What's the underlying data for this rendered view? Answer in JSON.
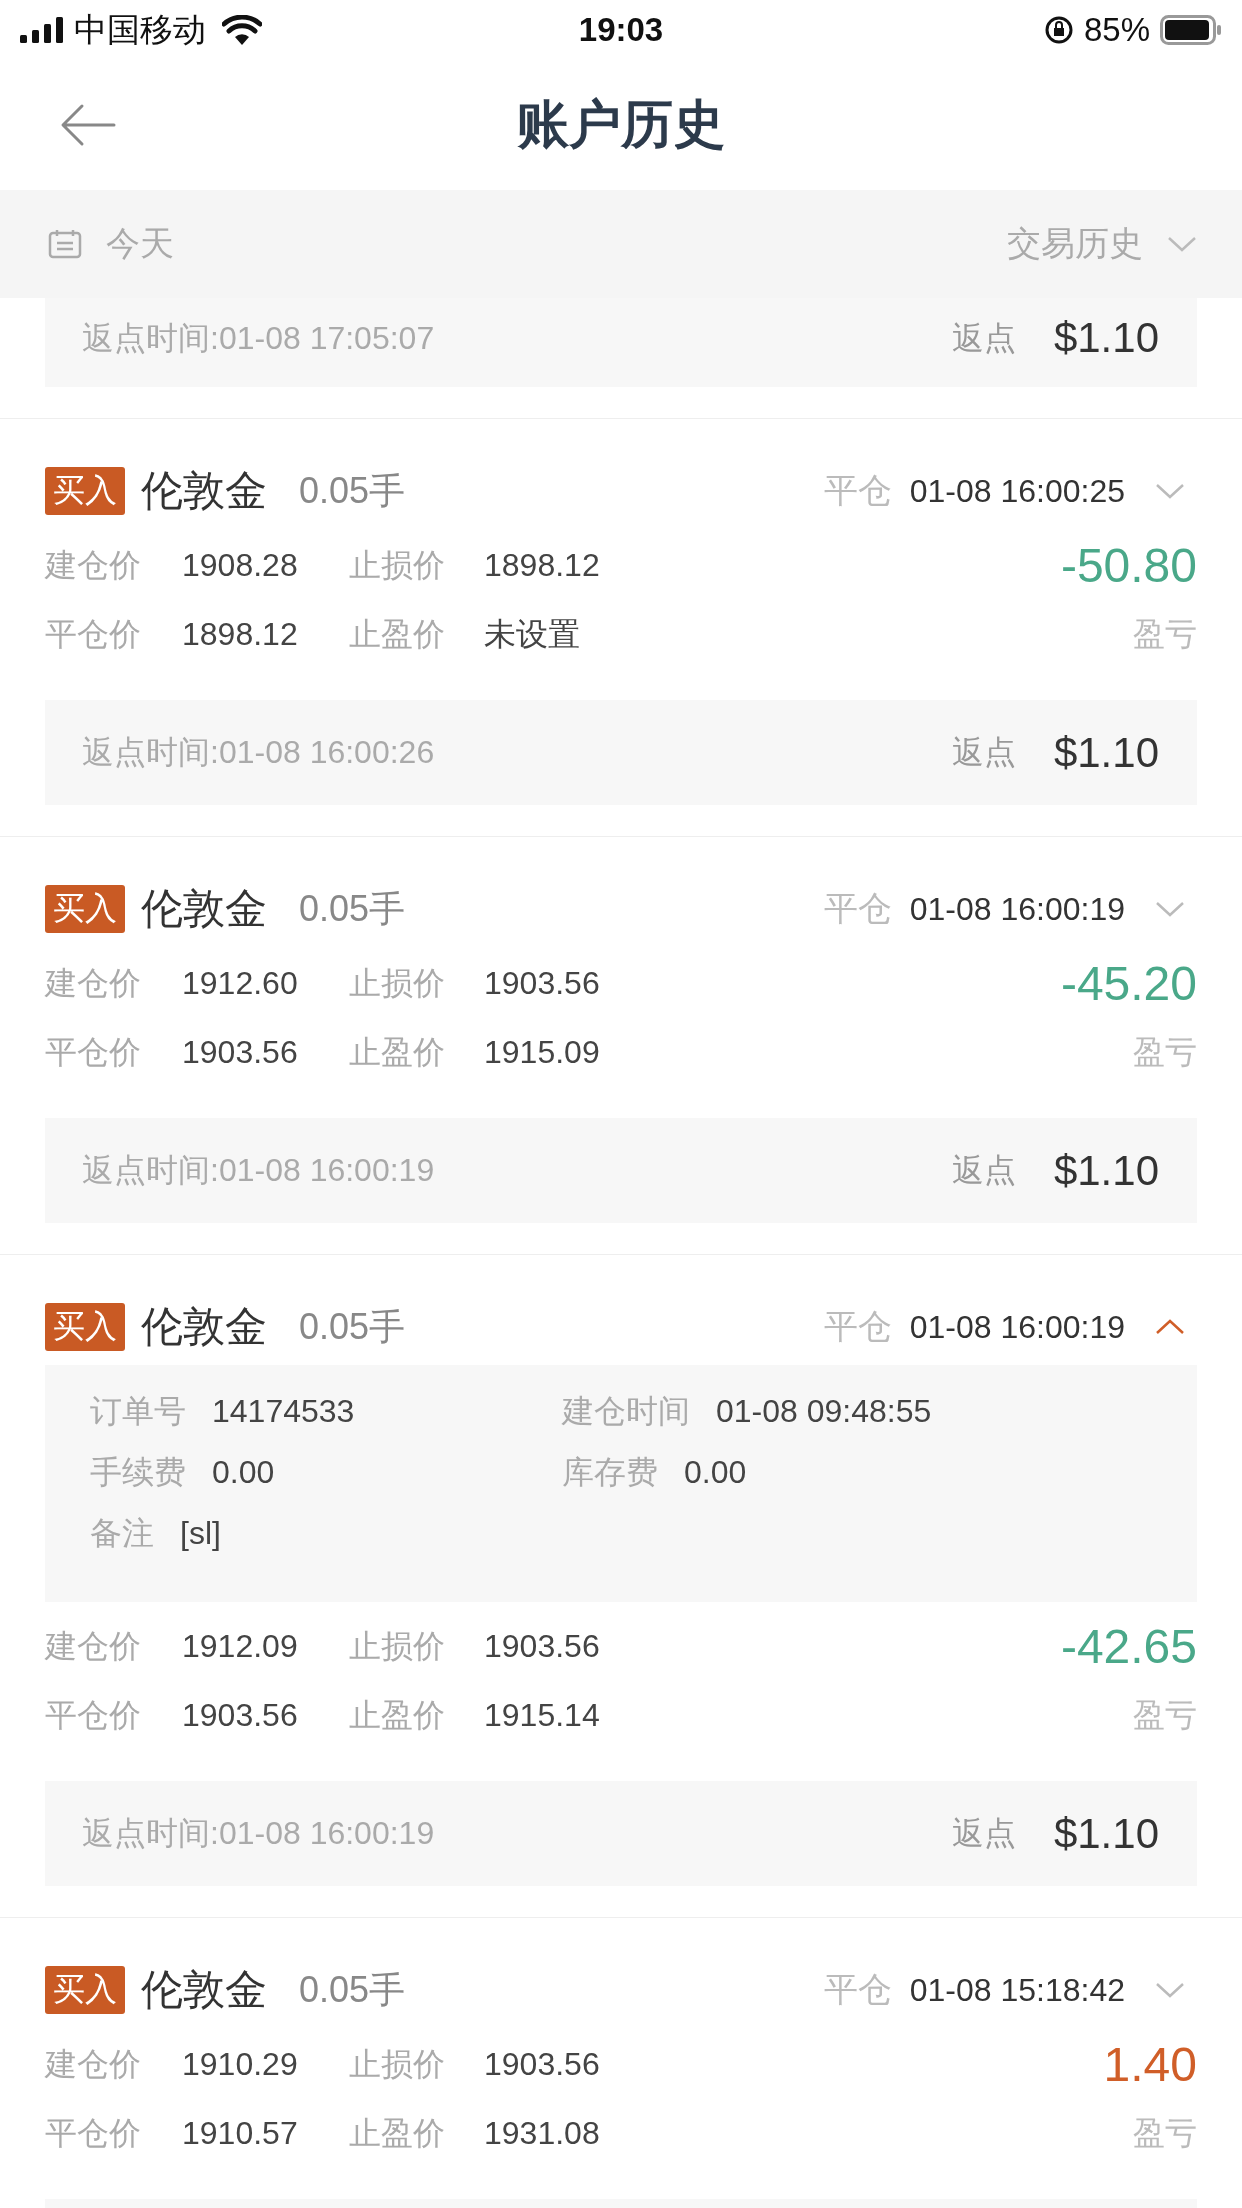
{
  "status_bar": {
    "carrier": "中国移动",
    "time": "19:03",
    "battery": "85%"
  },
  "nav": {
    "title": "账户历史"
  },
  "filter": {
    "date": "今天",
    "type": "交易历史"
  },
  "top_rebate": {
    "time": "返点时间:01-08 17:05:07",
    "label": "返点",
    "amount": "$1.10"
  },
  "trades": [
    {
      "tag": "买入",
      "symbol": "伦敦金",
      "lots": "0.05手",
      "status": "平仓",
      "close_time": "01-08 16:00:25",
      "expanded": false,
      "rows": [
        [
          {
            "label": "建仓价",
            "value": "1908.28"
          },
          {
            "label": "止损价",
            "value": "1898.12"
          }
        ],
        [
          {
            "label": "平仓价",
            "value": "1898.12"
          },
          {
            "label": "止盈价",
            "value": "未设置"
          }
        ]
      ],
      "pnl": {
        "value": "-50.80",
        "label": "盈亏",
        "color": "#4aa889"
      },
      "rebate": {
        "time": "返点时间:01-08 16:00:26",
        "label": "返点",
        "amount": "$1.10"
      }
    },
    {
      "tag": "买入",
      "symbol": "伦敦金",
      "lots": "0.05手",
      "status": "平仓",
      "close_time": "01-08 16:00:19",
      "expanded": false,
      "rows": [
        [
          {
            "label": "建仓价",
            "value": "1912.60"
          },
          {
            "label": "止损价",
            "value": "1903.56"
          }
        ],
        [
          {
            "label": "平仓价",
            "value": "1903.56"
          },
          {
            "label": "止盈价",
            "value": "1915.09"
          }
        ]
      ],
      "pnl": {
        "value": "-45.20",
        "label": "盈亏",
        "color": "#4aa889"
      },
      "rebate": {
        "time": "返点时间:01-08 16:00:19",
        "label": "返点",
        "amount": "$1.10"
      }
    },
    {
      "tag": "买入",
      "symbol": "伦敦金",
      "lots": "0.05手",
      "status": "平仓",
      "close_time": "01-08 16:00:19",
      "expanded": true,
      "details": [
        [
          {
            "label": "订单号",
            "value": "14174533"
          },
          {
            "label": "建仓时间",
            "value": "01-08 09:48:55"
          }
        ],
        [
          {
            "label": "手续费",
            "value": "0.00"
          },
          {
            "label": "库存费",
            "value": "0.00"
          }
        ],
        [
          {
            "label": "备注",
            "value": "[sl]"
          }
        ]
      ],
      "rows": [
        [
          {
            "label": "建仓价",
            "value": "1912.09"
          },
          {
            "label": "止损价",
            "value": "1903.56"
          }
        ],
        [
          {
            "label": "平仓价",
            "value": "1903.56"
          },
          {
            "label": "止盈价",
            "value": "1915.14"
          }
        ]
      ],
      "pnl": {
        "value": "-42.65",
        "label": "盈亏",
        "color": "#4aa889"
      },
      "rebate": {
        "time": "返点时间:01-08 16:00:19",
        "label": "返点",
        "amount": "$1.10"
      }
    },
    {
      "tag": "买入",
      "symbol": "伦敦金",
      "lots": "0.05手",
      "status": "平仓",
      "close_time": "01-08 15:18:42",
      "expanded": false,
      "rows": [
        [
          {
            "label": "建仓价",
            "value": "1910.29"
          },
          {
            "label": "止损价",
            "value": "1903.56"
          }
        ],
        [
          {
            "label": "平仓价",
            "value": "1910.57"
          },
          {
            "label": "止盈价",
            "value": "1931.08"
          }
        ]
      ],
      "pnl": {
        "value": "1.40",
        "label": "盈亏",
        "color": "#d05e28"
      }
    }
  ]
}
